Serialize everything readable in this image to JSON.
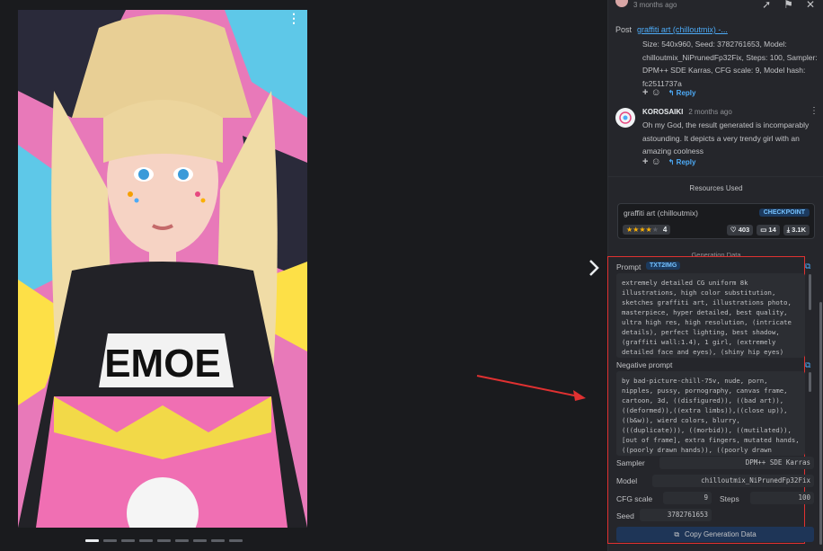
{
  "colors": {
    "accent": "#4dabf7",
    "highlight_box": "#e03131",
    "arrow": "#e03131"
  },
  "viewer": {
    "menu_icon": "dots-vertical-icon",
    "next_icon": "chevron-right-icon",
    "dots_total": 9,
    "dots_active": 1
  },
  "topbar": {
    "time": "3 months ago",
    "icons": [
      "share-icon",
      "flag-icon",
      "close-icon"
    ]
  },
  "post": {
    "label": "Post",
    "link": "graffiti art (chilloutmix) -..."
  },
  "comment1": {
    "text": "Size: 540x960, Seed: 3782761653, Model: chilloutmix_NiPrunedFp32Fix, Steps: 100, Sampler: DPM++ SDE Karras, CFG scale: 9, Model hash: fc2511737a",
    "plus": "+",
    "reply": "Reply"
  },
  "comment2": {
    "user": "KOROSAIKI",
    "time": "2 months ago",
    "text": "Oh my God, the result generated is incomparably astounding. It depicts a very trendy girl with an amazing coolness",
    "plus": "+",
    "reply": "Reply"
  },
  "resources": {
    "title": "Resources Used",
    "name": "graffiti art (chilloutmix)",
    "badge": "CHECKPOINT",
    "rating": 4,
    "rating_label": "4",
    "likes": "403",
    "comments": "14",
    "downloads": "3.1K"
  },
  "generation": {
    "title": "Generation Data",
    "prompt_label": "Prompt",
    "prompt_tag": "TXT2IMG",
    "prompt": "extremely detailed CG uniform 8k illustrations, high color substitution, sketches graffiti art, illustrations photo, masterpiece, hyper detailed, best quality, ultra high res, high resolution, (intricate details), perfect lighting, best shadow, (graffiti wall:1.4), 1 girl, (extremely detailed face and eyes), (shiny hip eyes)",
    "negative_label": "Negative prompt",
    "negative": "by bad-picture-chill-75v, nude, porn, nipples, pussy, pornography, canvas frame, cartoon, 3d, ((disfigured)), ((bad art)), ((deformed)),((extra limbs)),((close up)), ((b&w)), wierd colors, blurry, (((duplicate))), ((morbid)), ((mutilated)), [out of frame], extra fingers, mutated hands, ((poorly drawn hands)), ((poorly drawn",
    "sampler_label": "Sampler",
    "sampler": "DPM++ SDE Karras",
    "model_label": "Model",
    "model": "chilloutmix_NiPrunedFp32Fix",
    "cfg_label": "CFG scale",
    "cfg": "9",
    "steps_label": "Steps",
    "steps": "100",
    "seed_label": "Seed",
    "seed": "3782761653",
    "copy_button": "Copy Generation Data"
  }
}
